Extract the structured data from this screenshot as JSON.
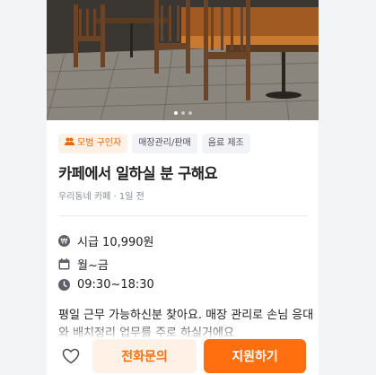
{
  "job": {
    "tags": {
      "model": "모범 구인자",
      "category": "매장관리/판매",
      "task": "음료 제조"
    },
    "title": "카페에서 일하실 분 구해요",
    "subtitle": "우리동네 카페 · 1일 전",
    "wage": "시급 10,990원",
    "days": "월~금",
    "hours": "09:30~18:30",
    "description": "평일 근무 가능하신분 찾아요. 매장 관리로 손님 응대와 배치정리 업무를 주로 하실거에요"
  },
  "actions": {
    "call_label": "전화문의",
    "apply_label": "지원하기"
  },
  "colors": {
    "accent": "#ff6f0f",
    "accent_soft": "#fff1e6"
  },
  "icons": {
    "model": "people-icon",
    "wage": "won-icon",
    "days": "calendar-icon",
    "hours": "clock-icon",
    "favorite": "heart-icon"
  }
}
